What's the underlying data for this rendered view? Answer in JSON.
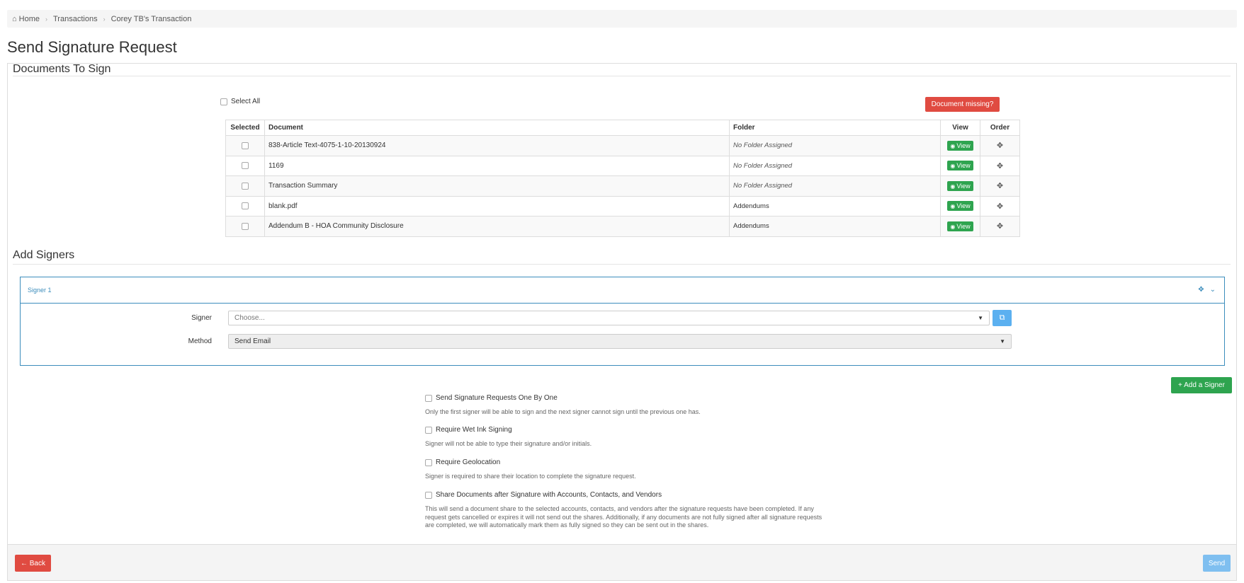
{
  "breadcrumb": {
    "home_icon": "home-icon",
    "items": [
      "Home",
      "Transactions",
      "Corey TB's Transaction"
    ]
  },
  "page_title": "Send Signature Request",
  "documents_section": {
    "title": "Documents To Sign",
    "select_all_label": "Select All",
    "missing_button": "Document missing?",
    "columns": [
      "Selected",
      "Document",
      "Folder",
      "View",
      "Order"
    ],
    "rows": [
      {
        "document": "838-Article Text-4075-1-10-20130924",
        "folder": "No Folder Assigned",
        "folder_assigned": false
      },
      {
        "document": "1169",
        "folder": "No Folder Assigned",
        "folder_assigned": false
      },
      {
        "document": "Transaction Summary",
        "folder": "No Folder Assigned",
        "folder_assigned": false
      },
      {
        "document": "blank.pdf",
        "folder": "Addendums",
        "folder_assigned": true
      },
      {
        "document": "Addendum B - HOA Community Disclosure",
        "folder": "Addendums",
        "folder_assigned": true
      }
    ],
    "view_label": "View"
  },
  "signers_section": {
    "title": "Add Signers",
    "signer_header": "Signer 1",
    "signer_label": "Signer",
    "signer_placeholder": "Choose...",
    "method_label": "Method",
    "method_value": "Send Email",
    "add_signer_button": "Add a Signer"
  },
  "options": [
    {
      "label": "Send Signature Requests One By One",
      "desc": "Only the first signer will be able to sign and the next signer cannot sign until the previous one has."
    },
    {
      "label": "Require Wet Ink Signing",
      "desc": "Signer will not be able to type their signature and/or initials."
    },
    {
      "label": "Require Geolocation",
      "desc": "Signer is required to share their location to complete the signature request."
    },
    {
      "label": "Share Documents after Signature with Accounts, Contacts, and Vendors",
      "desc": "This will send a document share to the selected accounts, contacts, and vendors after the signature requests have been completed. If any request gets cancelled or expires it will not send out the shares. Additionally, if any documents are not fully signed after all signature requests are completed, we will automatically mark them as fully signed so they can be sent out in the shares."
    }
  ],
  "footer": {
    "back_label": "Back",
    "send_label": "Send"
  },
  "colors": {
    "danger": "#e04b41",
    "success": "#2ea44f",
    "primary": "#3c8dbc",
    "send_disabled": "#7fbff0"
  }
}
